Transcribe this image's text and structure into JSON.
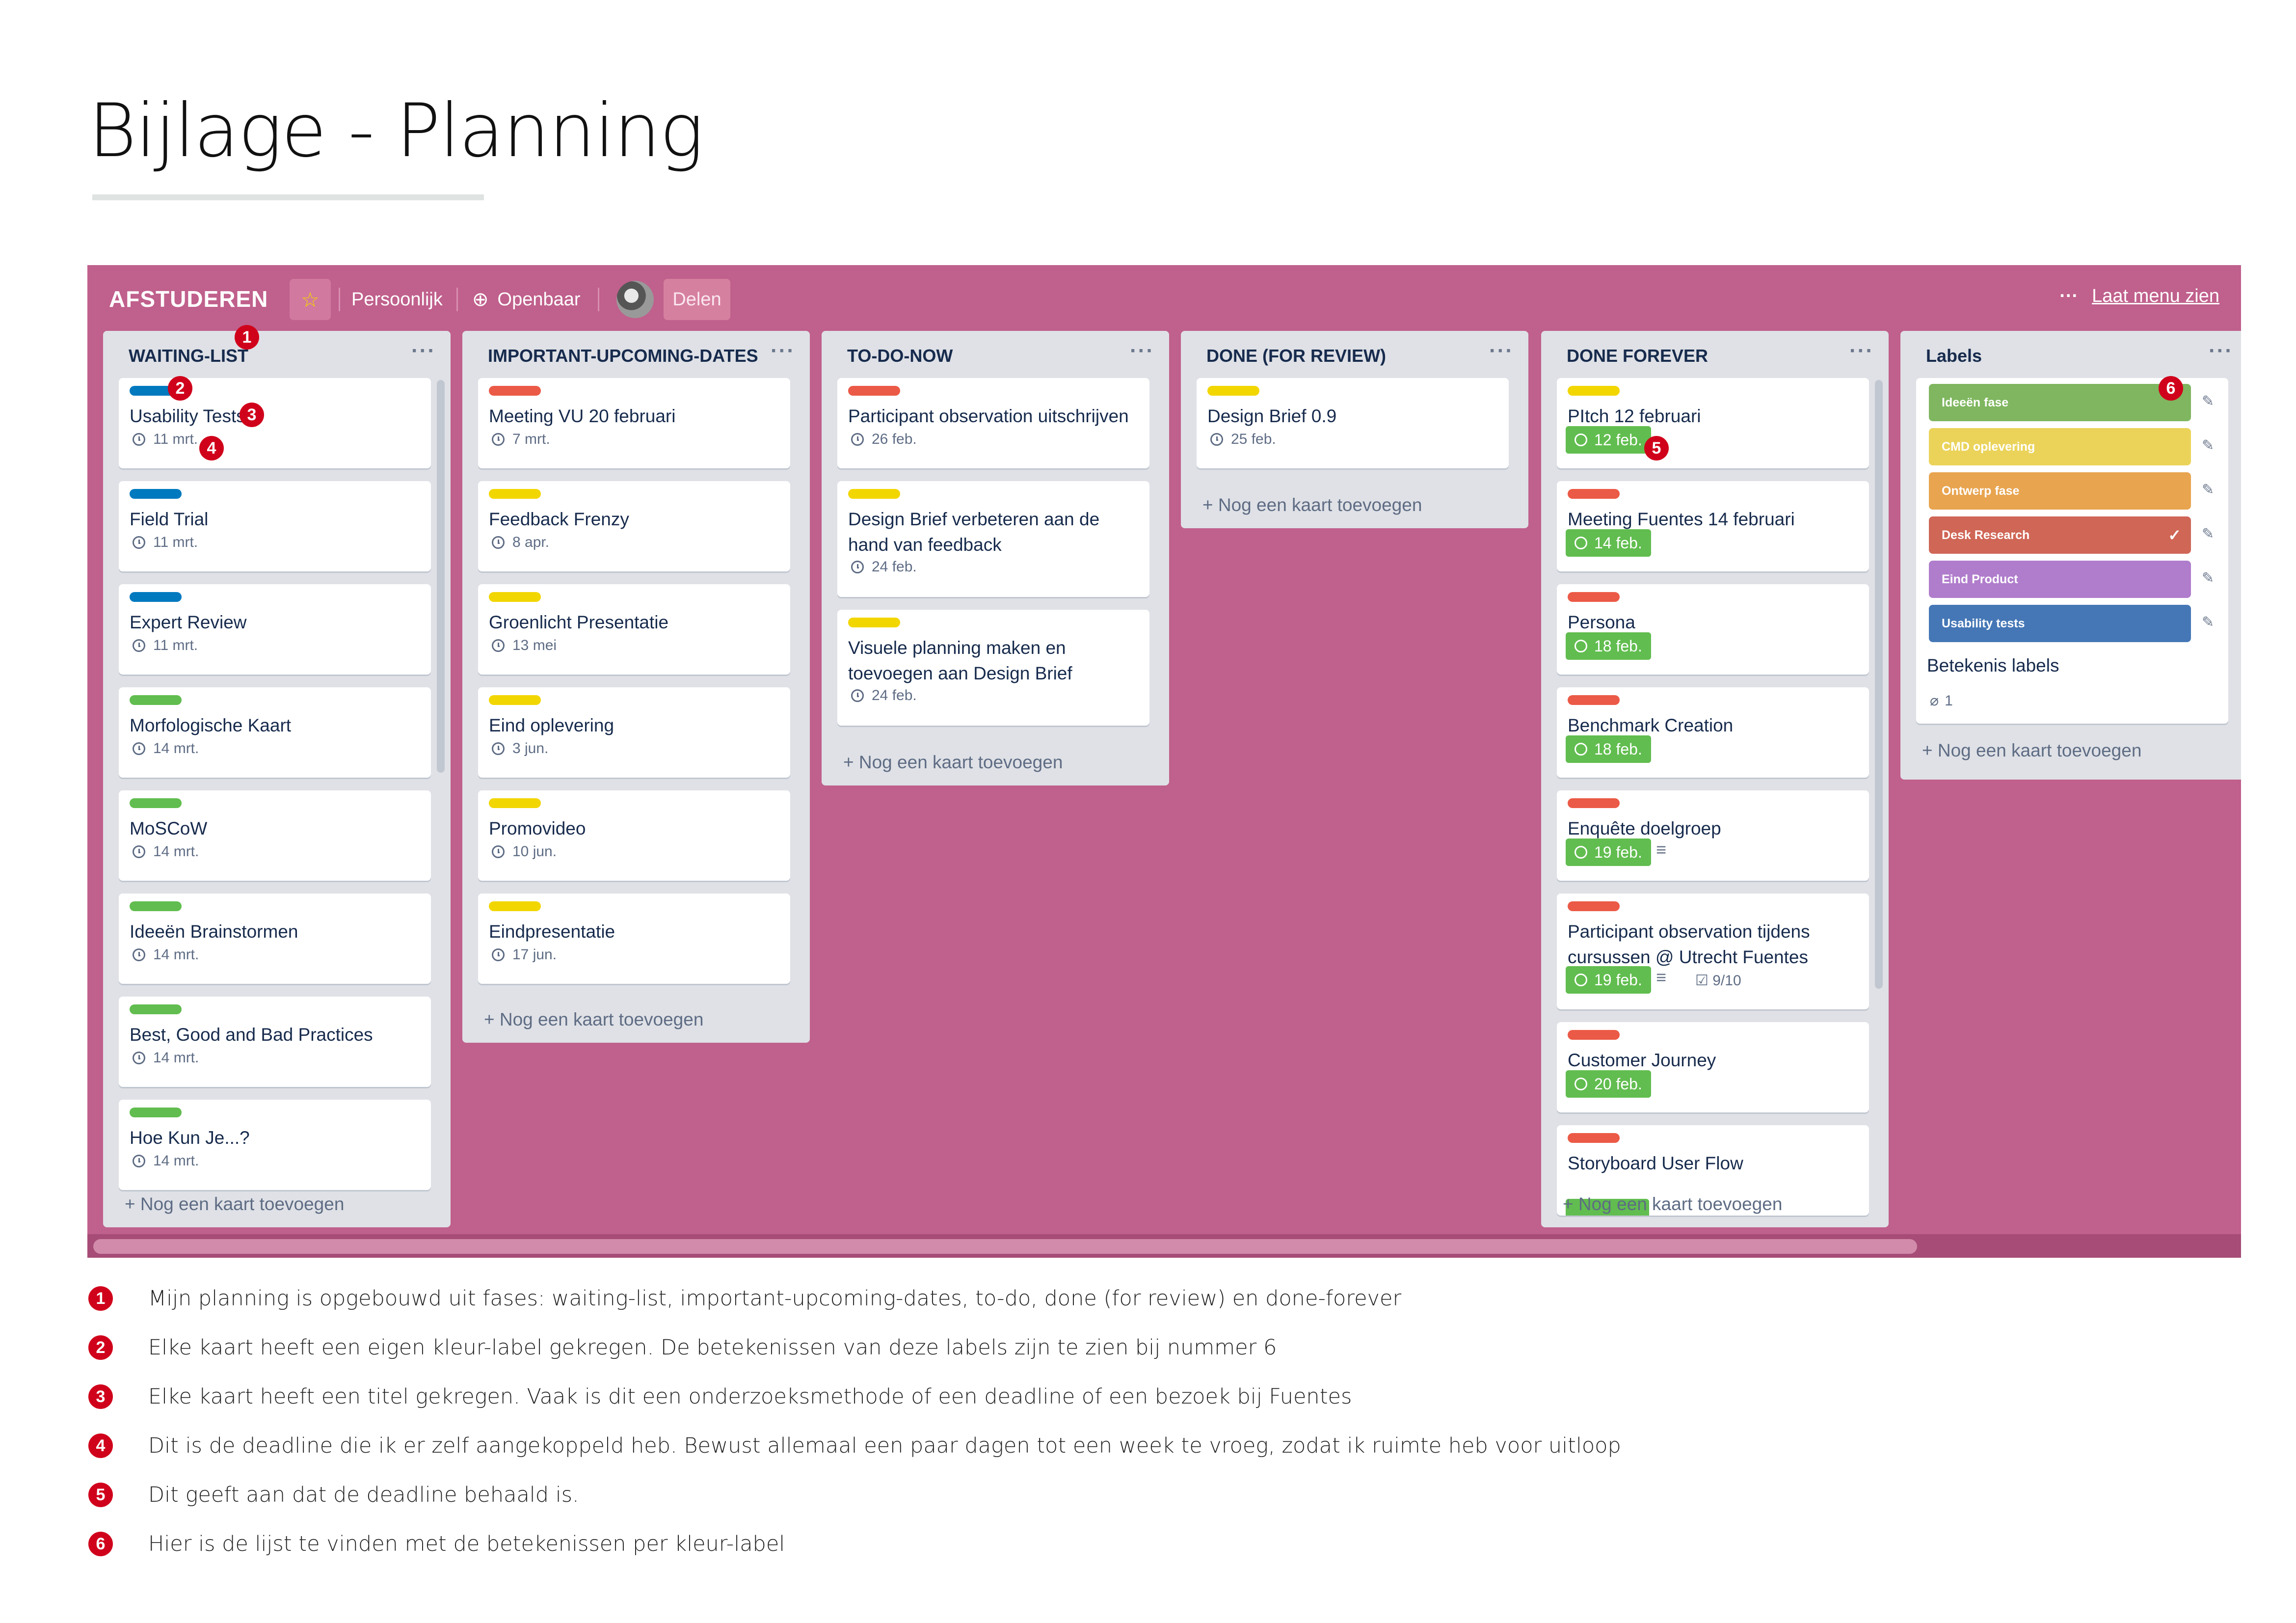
{
  "page": {
    "title": "Bijlage - Planning"
  },
  "header": {
    "board_name": "AFSTUDEREN",
    "star": "☆",
    "visibility_personal": "Persoonlijk",
    "visibility_public": "Openbaar",
    "globe": "⊕",
    "share": "Delen",
    "menu_dots": "···",
    "menu_label": "Laat menu zien"
  },
  "common": {
    "add_card": "+ Nog een kaart toevoegen",
    "list_menu": "···"
  },
  "lists": [
    {
      "title": "WAITING-LIST",
      "cards": [
        {
          "title": "Usability Tests",
          "due": "11 mrt."
        },
        {
          "title": "Field Trial",
          "due": "11 mrt."
        },
        {
          "title": "Expert Review",
          "due": "11 mrt."
        },
        {
          "title": "Morfologische Kaart",
          "due": "14 mrt."
        },
        {
          "title": "MoSCoW",
          "due": "14 mrt."
        },
        {
          "title": "Ideeën Brainstormen",
          "due": "14 mrt."
        },
        {
          "title": "Best, Good and Bad Practices",
          "due": "14 mrt."
        },
        {
          "title": "Hoe Kun Je...?",
          "due": "14 mrt."
        }
      ]
    },
    {
      "title": "IMPORTANT-UPCOMING-DATES",
      "cards": [
        {
          "title": "Meeting VU 20 februari",
          "due": "7 mrt."
        },
        {
          "title": "Feedback Frenzy",
          "due": "8 apr."
        },
        {
          "title": "Groenlicht Presentatie",
          "due": "13 mei"
        },
        {
          "title": "Eind oplevering",
          "due": "3 jun."
        },
        {
          "title": "Promovideo",
          "due": "10 jun."
        },
        {
          "title": "Eindpresentatie",
          "due": "17 jun."
        }
      ]
    },
    {
      "title": "TO-DO-NOW",
      "cards": [
        {
          "title": "Participant observation uitschrijven",
          "due": "26 feb."
        },
        {
          "title": "Design Brief verbeteren aan de hand van feedback",
          "due": "24 feb."
        },
        {
          "title": "Visuele planning maken en toevoegen aan Design Brief",
          "due": "24 feb."
        }
      ]
    },
    {
      "title": "DONE (FOR REVIEW)",
      "cards": [
        {
          "title": "Design Brief 0.9",
          "due": "25 feb."
        }
      ]
    },
    {
      "title": "DONE FOREVER",
      "cards": [
        {
          "title": "PItch 12 februari",
          "due": "12 feb."
        },
        {
          "title": "Meeting Fuentes 14 februari",
          "due": "14 feb."
        },
        {
          "title": "Persona",
          "due": "18 feb."
        },
        {
          "title": "Benchmark Creation",
          "due": "18 feb."
        },
        {
          "title": "Enquête doelgroep",
          "due": "19 feb."
        },
        {
          "title": "Participant observation tijdens cursussen @ Utrecht Fuentes",
          "due": "19 feb.",
          "checklist": "9/10"
        },
        {
          "title": "Customer Journey",
          "due": "20 feb."
        },
        {
          "title": "Storyboard User Flow"
        }
      ]
    },
    {
      "title": "Labels",
      "labels": [
        {
          "name": "Ideeën fase",
          "color": "#7fb65f"
        },
        {
          "name": "CMD oplevering",
          "color": "#ebd35a"
        },
        {
          "name": "Ontwerp fase",
          "color": "#e8a44f"
        },
        {
          "name": "Desk Research",
          "color": "#cf6656"
        },
        {
          "name": "Eind Product",
          "color": "#b07ccc"
        },
        {
          "name": "Usability tests",
          "color": "#4577b6"
        }
      ],
      "card_title": "Betekenis labels",
      "attachments": "1"
    }
  ],
  "colors": {
    "green": "#61bd4f",
    "yellow": "#f2d600",
    "red": "#eb5a46",
    "blue": "#0079bf",
    "board": "#c0608c"
  },
  "markers": [
    "1",
    "2",
    "3",
    "4",
    "5",
    "6"
  ],
  "legend": [
    {
      "num": "1",
      "text": "Mijn planning is opgebouwd uit fases: waiting-list, important-upcoming-dates, to-do, done (for review) en done-forever"
    },
    {
      "num": "2",
      "text": "Elke kaart heeft een eigen kleur-label gekregen. De betekenissen van deze labels zijn te zien bij nummer 6"
    },
    {
      "num": "3",
      "text": "Elke kaart heeft een titel gekregen. Vaak is dit een onderzoeksmethode of een deadline of een bezoek bij Fuentes"
    },
    {
      "num": "4",
      "text": "Dit is de deadline die ik er zelf aangekoppeld heb. Bewust allemaal een paar dagen tot een week te vroeg, zodat ik ruimte heb voor uitloop"
    },
    {
      "num": "5",
      "text": "Dit geeft aan dat de deadline behaald is."
    },
    {
      "num": "6",
      "text": "Hier is de lijst te vinden met de betekenissen per kleur-label"
    }
  ]
}
